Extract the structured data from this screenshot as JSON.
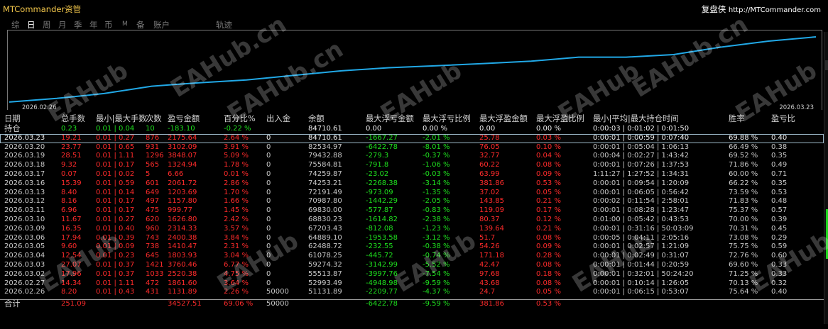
{
  "app_title": "MTCommander资管",
  "brand": {
    "name": "复盘侠",
    "url": "http://MTCommander.com"
  },
  "tabs": [
    {
      "label": "综",
      "active": false
    },
    {
      "label": "日",
      "active": true
    },
    {
      "label": "周",
      "active": false
    },
    {
      "label": "月",
      "active": false
    },
    {
      "label": "季",
      "active": false
    },
    {
      "label": "年",
      "active": false
    },
    {
      "label": "币",
      "active": false
    },
    {
      "label": "M",
      "active": false
    },
    {
      "label": "备",
      "active": false
    },
    {
      "label": "账户",
      "active": false
    },
    {
      "label": "轨迹",
      "active": false
    }
  ],
  "chart": {
    "date_start": "2026.02.26",
    "date_end": "2026.03.23",
    "line_color": "#21a8e6",
    "grid": false,
    "balance_series": [
      51131.89,
      52993.49,
      55513.87,
      59274.32,
      61078.25,
      62488.72,
      64889.1,
      67203.43,
      68830.23,
      69830.0,
      70987.8,
      72191.49,
      74253.21,
      74259.87,
      75584.81,
      79432.88,
      82534.97,
      84710.61
    ]
  },
  "watermark": "EAHub.cn",
  "watermark_short": "EAHub",
  "headers": [
    "日期",
    "总手数",
    "最小|最大手数",
    "次数",
    "盈亏金额",
    "百分比%",
    "出入金",
    "余额",
    "最大浮亏金额",
    "最大浮亏比例",
    "最大浮盈金额",
    "最大浮盈比例",
    "最小|平均|最大持仓时间",
    "胜率",
    "盈亏比"
  ],
  "holding": {
    "label": "持仓",
    "lots": "0.23",
    "minmax": "0.01 | 0.04",
    "count": "10",
    "pnl": "-183.10",
    "pct": "-0.22 %",
    "flow": "",
    "balance": "84710.61",
    "maxdd": "0.00",
    "maxdd_pct": "0.00 %",
    "maxfp": "0.00",
    "maxfp_pct": "0.00 %",
    "time": "0:00:03 | 0:01:02 | 0:01:50",
    "win": "",
    "pl": ""
  },
  "rows": [
    {
      "date": "2026.03.23",
      "lots": "19.21",
      "minmax": "0.01 | 0.27",
      "count": "876",
      "pnl": "2175.64",
      "pct": "2.64 %",
      "flow": "0",
      "balance": "84710.61",
      "maxdd": "-1667.27",
      "maxdd_pct": "-2.01 %",
      "maxfp": "25.78",
      "maxfp_pct": "0.03 %",
      "time": "0:00:01 | 0:00:59 | 0:07:40",
      "win": "69.88 %",
      "pl": "0.40"
    },
    {
      "date": "2026.03.20",
      "lots": "23.77",
      "minmax": "0.01 | 0.65",
      "count": "931",
      "pnl": "3102.09",
      "pct": "3.91 %",
      "flow": "0",
      "balance": "82534.97",
      "maxdd": "-6422.78",
      "maxdd_pct": "-8.01 %",
      "maxfp": "76.05",
      "maxfp_pct": "0.10 %",
      "time": "0:00:01 | 0:05:04 | 1:06:13",
      "win": "66.49 %",
      "pl": "0.38"
    },
    {
      "date": "2026.03.19",
      "lots": "28.51",
      "minmax": "0.01 | 1.11",
      "count": "1296",
      "pnl": "3848.07",
      "pct": "5.09 %",
      "flow": "0",
      "balance": "79432.88",
      "maxdd": "-279.3",
      "maxdd_pct": "-0.37 %",
      "maxfp": "32.77",
      "maxfp_pct": "0.04 %",
      "time": "0:00:04 | 0:02:27 | 1:43:42",
      "win": "69.52 %",
      "pl": "0.35"
    },
    {
      "date": "2026.03.18",
      "lots": "9.32",
      "minmax": "0.01 | 0.17",
      "count": "565",
      "pnl": "1324.94",
      "pct": "1.78 %",
      "flow": "0",
      "balance": "75584.81",
      "maxdd": "-791.8",
      "maxdd_pct": "-1.06 %",
      "maxfp": "60.22",
      "maxfp_pct": "0.08 %",
      "time": "0:00:01 | 0:07:26 | 1:37:53",
      "win": "71.86 %",
      "pl": "0.49"
    },
    {
      "date": "2026.03.17",
      "lots": "0.07",
      "minmax": "0.01 | 0.02",
      "count": "5",
      "pnl": "6.66",
      "pct": "0.01 %",
      "flow": "0",
      "balance": "74259.87",
      "maxdd": "-23.02",
      "maxdd_pct": "-0.03 %",
      "maxfp": "63.99",
      "maxfp_pct": "0.09 %",
      "time": "1:11:27 | 1:27:52 | 1:34:31",
      "win": "60.00 %",
      "pl": "0.71"
    },
    {
      "date": "2026.03.16",
      "lots": "15.39",
      "minmax": "0.01 | 0.59",
      "count": "601",
      "pnl": "2061.72",
      "pct": "2.86 %",
      "flow": "0",
      "balance": "74253.21",
      "maxdd": "-2268.38",
      "maxdd_pct": "-3.14 %",
      "maxfp": "381.86",
      "maxfp_pct": "0.53 %",
      "time": "0:00:01 | 0:09:54 | 1:20:09",
      "win": "66.22 %",
      "pl": "0.35"
    },
    {
      "date": "2026.03.13",
      "lots": "8.40",
      "minmax": "0.01 | 0.14",
      "count": "649",
      "pnl": "1203.69",
      "pct": "1.70 %",
      "flow": "0",
      "balance": "72191.49",
      "maxdd": "-973.09",
      "maxdd_pct": "-1.35 %",
      "maxfp": "37.02",
      "maxfp_pct": "0.05 %",
      "time": "0:00:01 | 0:06:05 | 0:56:42",
      "win": "73.59 %",
      "pl": "0.53"
    },
    {
      "date": "2026.03.12",
      "lots": "8.16",
      "minmax": "0.01 | 0.17",
      "count": "497",
      "pnl": "1157.80",
      "pct": "1.66 %",
      "flow": "0",
      "balance": "70987.80",
      "maxdd": "-1442.29",
      "maxdd_pct": "-2.05 %",
      "maxfp": "143.85",
      "maxfp_pct": "0.21 %",
      "time": "0:00:02 | 0:11:54 | 2:58:01",
      "win": "71.83 %",
      "pl": "0.48"
    },
    {
      "date": "2026.03.11",
      "lots": "6.96",
      "minmax": "0.01 | 0.17",
      "count": "475",
      "pnl": "999.77",
      "pct": "1.45 %",
      "flow": "0",
      "balance": "69830.00",
      "maxdd": "-577.87",
      "maxdd_pct": "-0.83 %",
      "maxfp": "119.09",
      "maxfp_pct": "0.17 %",
      "time": "0:00:01 | 0:08:28 | 1:23:47",
      "win": "75.37 %",
      "pl": "0.57"
    },
    {
      "date": "2026.03.10",
      "lots": "11.67",
      "minmax": "0.01 | 0.27",
      "count": "620",
      "pnl": "1626.80",
      "pct": "2.42 %",
      "flow": "0",
      "balance": "68830.23",
      "maxdd": "-1614.82",
      "maxdd_pct": "-2.38 %",
      "maxfp": "80.37",
      "maxfp_pct": "0.12 %",
      "time": "0:01:00 | 0:05:42 | 0:43:53",
      "win": "70.00 %",
      "pl": "0.39"
    },
    {
      "date": "2026.03.09",
      "lots": "16.35",
      "minmax": "0.01 | 0.40",
      "count": "960",
      "pnl": "2314.33",
      "pct": "3.57 %",
      "flow": "0",
      "balance": "67203.43",
      "maxdd": "-812.08",
      "maxdd_pct": "-1.23 %",
      "maxfp": "139.64",
      "maxfp_pct": "0.21 %",
      "time": "0:00:01 | 0:31:16 | 50:03:09",
      "win": "70.31 %",
      "pl": "0.45"
    },
    {
      "date": "2026.03.06",
      "lots": "17.94",
      "minmax": "0.01 | 0.39",
      "count": "743",
      "pnl": "2400.38",
      "pct": "3.84 %",
      "flow": "0",
      "balance": "64889.10",
      "maxdd": "-1953.58",
      "maxdd_pct": "-3.12 %",
      "maxfp": "51.7",
      "maxfp_pct": "0.08 %",
      "time": "0:00:05 | 0:04:11 | 2:05:16",
      "win": "73.08 %",
      "pl": "0.29"
    },
    {
      "date": "2026.03.05",
      "lots": "9.60",
      "minmax": "0.01 | 0.09",
      "count": "738",
      "pnl": "1410.47",
      "pct": "2.31 %",
      "flow": "0",
      "balance": "62488.72",
      "maxdd": "-232.55",
      "maxdd_pct": "-0.38 %",
      "maxfp": "54.26",
      "maxfp_pct": "0.09 %",
      "time": "0:00:01 | 0:02:57 | 1:21:09",
      "win": "75.75 %",
      "pl": "0.59"
    },
    {
      "date": "2026.03.04",
      "lots": "12.54",
      "minmax": "0.01 | 0.23",
      "count": "645",
      "pnl": "1803.93",
      "pct": "3.04 %",
      "flow": "0",
      "balance": "61078.25",
      "maxdd": "-445.72",
      "maxdd_pct": "-0.74 %",
      "maxfp": "171.18",
      "maxfp_pct": "0.28 %",
      "time": "0:00:01 | 0:02:49 | 0:31:07",
      "win": "72.76 %",
      "pl": "0.60"
    },
    {
      "date": "2026.03.03",
      "lots": "27.07",
      "minmax": "0.01 | 0.37",
      "count": "1421",
      "pnl": "3760.46",
      "pct": "6.77 %",
      "flow": "0",
      "balance": "59274.32",
      "maxdd": "-3142.99",
      "maxdd_pct": "-5.52 %",
      "maxfp": "42.47",
      "maxfp_pct": "0.08 %",
      "time": "0:00:01 | 0:01:44 | 0:20:59",
      "win": "69.60 %",
      "pl": "0.33"
    },
    {
      "date": "2026.03.02",
      "lots": "17.96",
      "minmax": "0.01 | 0.37",
      "count": "1033",
      "pnl": "2520.38",
      "pct": "4.75 %",
      "flow": "0",
      "balance": "55513.87",
      "maxdd": "-3997.76",
      "maxdd_pct": "-7.54 %",
      "maxfp": "97.68",
      "maxfp_pct": "0.18 %",
      "time": "0:00:01 | 0:32:01 | 50:24:20",
      "win": "71.25 %",
      "pl": "0.33"
    },
    {
      "date": "2026.02.27",
      "lots": "14.34",
      "minmax": "0.01 | 1.11",
      "count": "472",
      "pnl": "1861.60",
      "pct": "3.64 %",
      "flow": "0",
      "balance": "52993.49",
      "maxdd": "-4948.98",
      "maxdd_pct": "-9.59 %",
      "maxfp": "43.68",
      "maxfp_pct": "0.08 %",
      "time": "0:00:01 | 0:10:14 | 1:26:05",
      "win": "70.13 %",
      "pl": "0.32"
    },
    {
      "date": "2026.02.26",
      "lots": "8.20",
      "minmax": "0.01 | 0.43",
      "count": "431",
      "pnl": "1131.89",
      "pct": "2.26 %",
      "flow": "50000",
      "balance": "51131.89",
      "maxdd": "-2209.77",
      "maxdd_pct": "-4.37 %",
      "maxfp": "24.7",
      "maxfp_pct": "0.05 %",
      "time": "0:00:01 | 0:06:15 | 0:53:07",
      "win": "75.64 %",
      "pl": "0.40"
    }
  ],
  "total": {
    "label": "合计",
    "lots": "251.09",
    "minmax": "",
    "count": "",
    "pnl": "34527.51",
    "pct": "69.06 %",
    "flow": "50000",
    "balance": "",
    "maxdd": "-6422.78",
    "maxdd_pct": "-9.59 %",
    "maxfp": "381.86",
    "maxfp_pct": "0.53 %",
    "time": "",
    "win": "",
    "pl": ""
  }
}
